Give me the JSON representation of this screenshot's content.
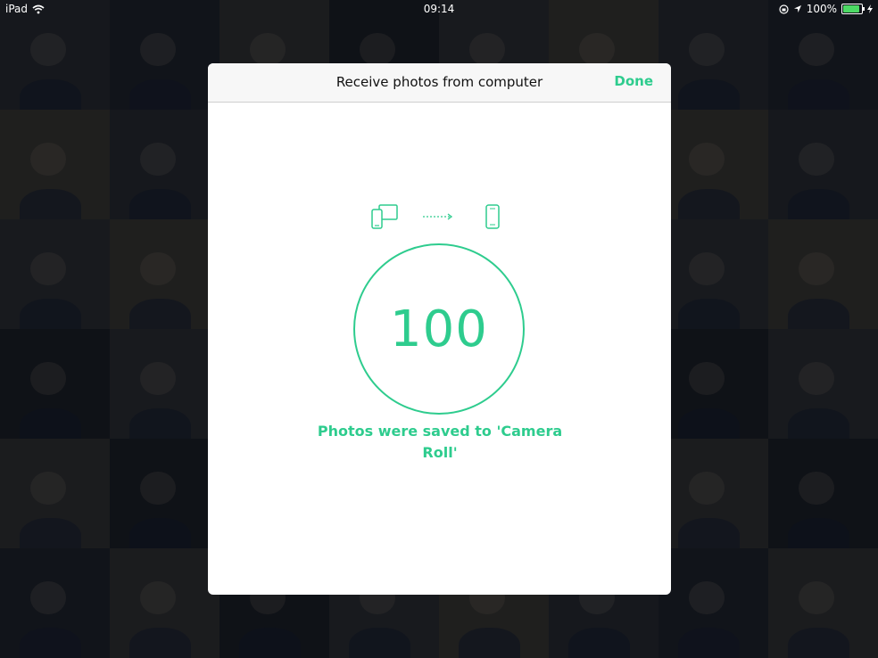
{
  "status_bar": {
    "device": "iPad",
    "time": "09:14",
    "battery": "100%",
    "battery_level": 1.0
  },
  "dialog": {
    "title": "Receive photos from computer",
    "done_label": "Done",
    "count": "100",
    "message": "Photos were saved to 'Camera Roll'"
  },
  "icons": {
    "wifi": "wifi-icon",
    "rotation_lock": "rotation-lock-icon",
    "location": "location-arrow-icon",
    "battery": "battery-icon",
    "charging": "charging-bolt-icon",
    "computer": "computer-devices-icon",
    "arrow": "transfer-arrow-icon",
    "phone": "phone-icon"
  },
  "colors": {
    "accent": "#2ecc8e",
    "battery_fill": "#4cd964"
  }
}
